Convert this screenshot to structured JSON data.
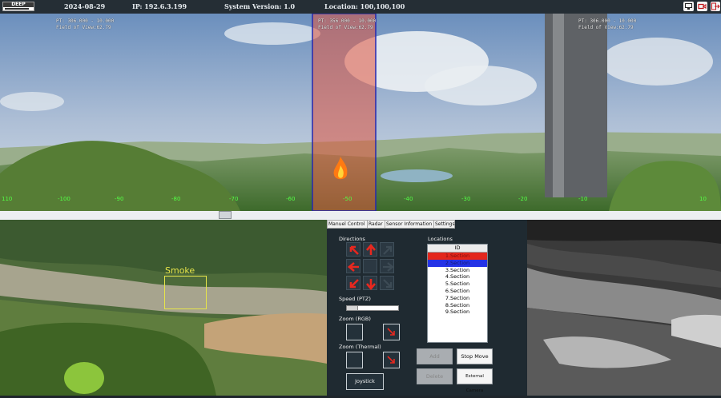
{
  "topbar": {
    "logo_text": "DEEP",
    "date": "2024-08-29",
    "ip": "IP: 192.6.3.199",
    "version": "System Version: 1.0",
    "location": "Location: 100,100,100",
    "icons": [
      "monitor-icon",
      "camera-icon",
      "exit-icon"
    ]
  },
  "panorama": {
    "left_overlay": [
      "PT: 306.000 - 10.000",
      "Field of View:62.79"
    ],
    "mid_overlay": [
      "PT: 356.000 - 10.000",
      "Field of View:62.79"
    ],
    "right_overlay": [
      "PT: 306.000 - 10.000",
      "Field of View:62.79"
    ],
    "ticks": [
      "110",
      "-100",
      "-90",
      "-80",
      "-70",
      "-60",
      "-50",
      "-40",
      "-30",
      "-20",
      "-10",
      "10"
    ],
    "tick_color": "#53ff45",
    "highlight_color": "#e0553f",
    "fire_icon": "fire-icon"
  },
  "camera": {
    "detection_label": "Smoke",
    "detection_color": "#e7e54a"
  },
  "tabs": [
    "Manuel Control",
    "Radar",
    "Sensor Information",
    "Settings"
  ],
  "controls": {
    "directions_label": "Directions",
    "speed_label": "Speed (PTZ)",
    "speed_value": 0.2,
    "zoom_rgb_label": "Zoom (RGB)",
    "zoom_thermal_label": "Zoom (Thermal)",
    "joystick_label": "Joystick",
    "arrow_color": "#e8281f"
  },
  "locations": {
    "label": "Locations",
    "header": "ID",
    "rows": [
      "1.Section",
      "2.Section",
      "3.Section",
      "4.Section",
      "5.Section",
      "6.Section",
      "7.Section",
      "8.Section",
      "9.Section"
    ],
    "row_colors": [
      "#e3261c",
      "#2432e6"
    ]
  },
  "buttons": {
    "add": "Add",
    "stop_move": "Stop Move",
    "delete": "Delete",
    "external_camera": "External Camera"
  }
}
